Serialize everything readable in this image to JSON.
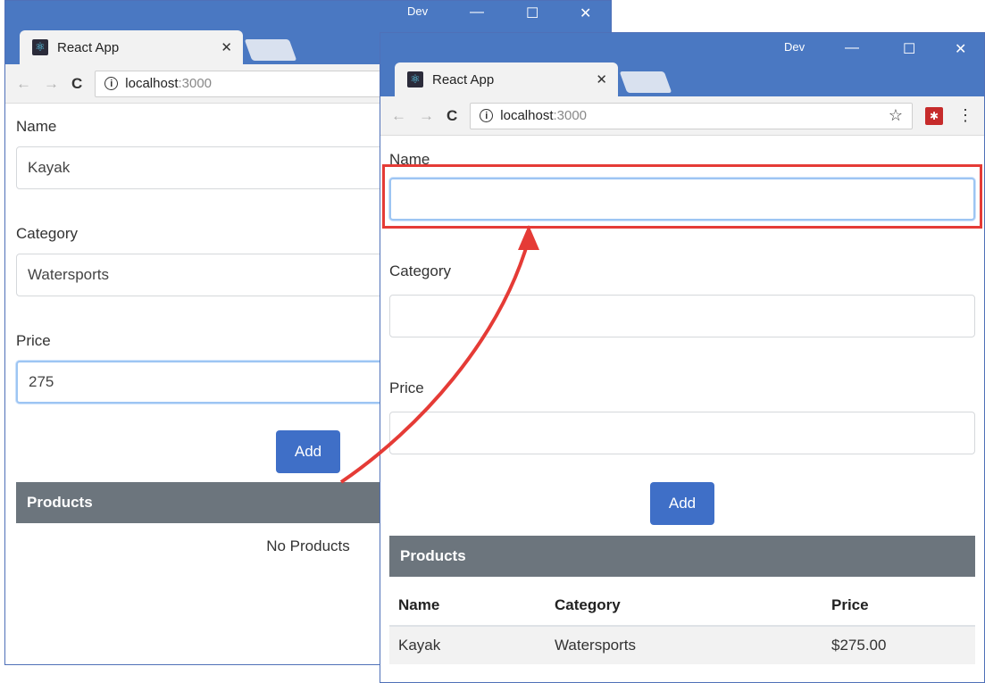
{
  "back_window": {
    "profile": "Dev",
    "controls": {
      "minimize": "—",
      "maximize": "☐",
      "close": "✕"
    },
    "tab": {
      "title": "React App",
      "close": "✕"
    },
    "address": {
      "host": "localhost",
      "port": ":3000"
    },
    "form": {
      "name_label": "Name",
      "name_value": "Kayak",
      "category_label": "Category",
      "category_value": "Watersports",
      "price_label": "Price",
      "price_value": "275",
      "add_label": "Add"
    },
    "products_header": "Products",
    "empty_message": "No Products"
  },
  "front_window": {
    "profile": "Dev",
    "controls": {
      "minimize": "—",
      "maximize": "☐",
      "close": "✕"
    },
    "tab": {
      "title": "React App",
      "close": "✕"
    },
    "address": {
      "host": "localhost",
      "port": ":3000"
    },
    "form": {
      "name_label": "Name",
      "name_value": "",
      "category_label": "Category",
      "category_value": "",
      "price_label": "Price",
      "price_value": "",
      "add_label": "Add"
    },
    "products_header": "Products",
    "table": {
      "columns": [
        "Name",
        "Category",
        "Price"
      ],
      "rows": [
        [
          "Kayak",
          "Watersports",
          "$275.00"
        ]
      ]
    }
  },
  "icons": {
    "back": "arrow-left",
    "forward": "arrow-right",
    "reload": "refresh",
    "info": "info-circle",
    "star": "bookmark-star",
    "extension": "extension",
    "menu": "kebab-menu",
    "favicon": "react-logo"
  },
  "colors": {
    "titlebar": "#4a78c2",
    "button": "#3f6fc7",
    "products_header": "#6c757d",
    "highlight": "#e53b36",
    "focus": "#9dc5f3"
  }
}
